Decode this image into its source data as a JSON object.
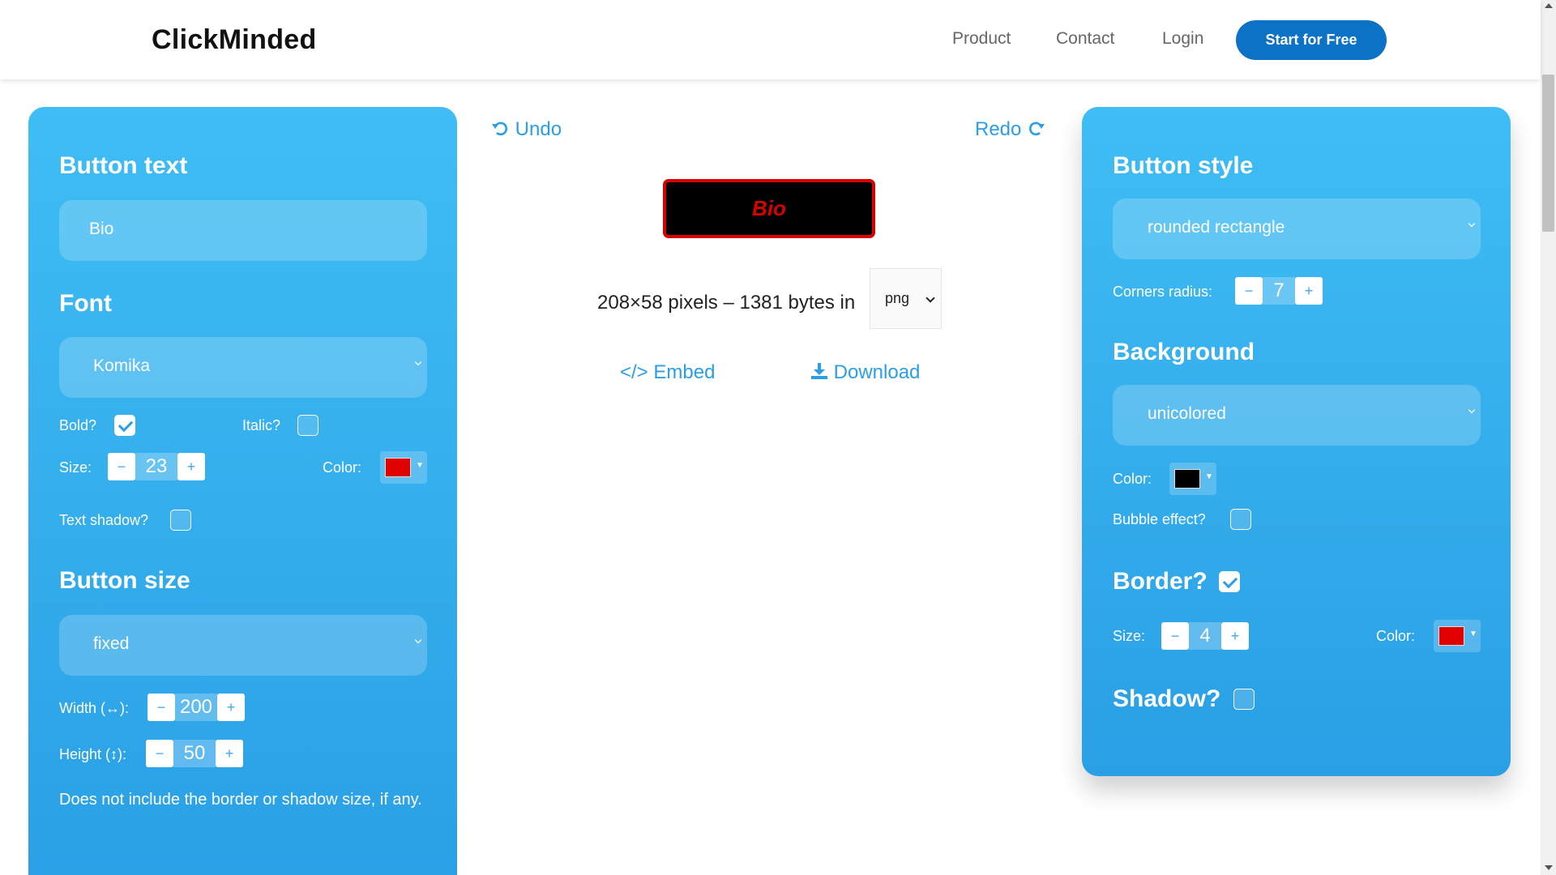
{
  "header": {
    "logo": "ClickMinded",
    "nav": [
      "Product",
      "Contact",
      "Login"
    ],
    "cta": "Start for Free"
  },
  "left_panel": {
    "button_text_title": "Button text",
    "button_text_value": "Bio",
    "font_title": "Font",
    "font_value": "Komika",
    "bold_label": "Bold?",
    "bold_checked": true,
    "italic_label": "Italic?",
    "italic_checked": false,
    "size_label": "Size:",
    "size_value": "23",
    "color_label": "Color:",
    "text_color": "#e00000",
    "text_shadow_label": "Text shadow?",
    "text_shadow_checked": false,
    "button_size_title": "Button size",
    "button_size_value": "fixed",
    "width_label": "Width (↔):",
    "width_value": "200",
    "height_label": "Height (↕):",
    "height_value": "50",
    "note": "Does not include the border or shadow size, if any.",
    "minus": "−",
    "plus": "+"
  },
  "center": {
    "undo": "Undo",
    "redo": "Redo",
    "preview_text": "Bio",
    "meta": "208×58 pixels – 1381 bytes in",
    "format": "png",
    "embed": "Embed",
    "download": "Download"
  },
  "right_panel": {
    "style_title": "Button style",
    "style_value": "rounded rectangle",
    "corners_label": "Corners radius:",
    "corners_value": "7",
    "background_title": "Background",
    "background_value": "unicolored",
    "color_label": "Color:",
    "bg_color": "#000000",
    "bubble_label": "Bubble effect?",
    "bubble_checked": false,
    "border_title": "Border?",
    "border_checked": true,
    "border_size_label": "Size:",
    "border_size_value": "4",
    "border_color_label": "Color:",
    "border_color": "#e00000",
    "shadow_title": "Shadow?",
    "shadow_checked": false
  },
  "colors": {
    "accent": "#2a9fe5",
    "cta": "#0b72c6",
    "panel_top": "#3fbdf4",
    "panel_bottom": "#2a9fe5"
  }
}
